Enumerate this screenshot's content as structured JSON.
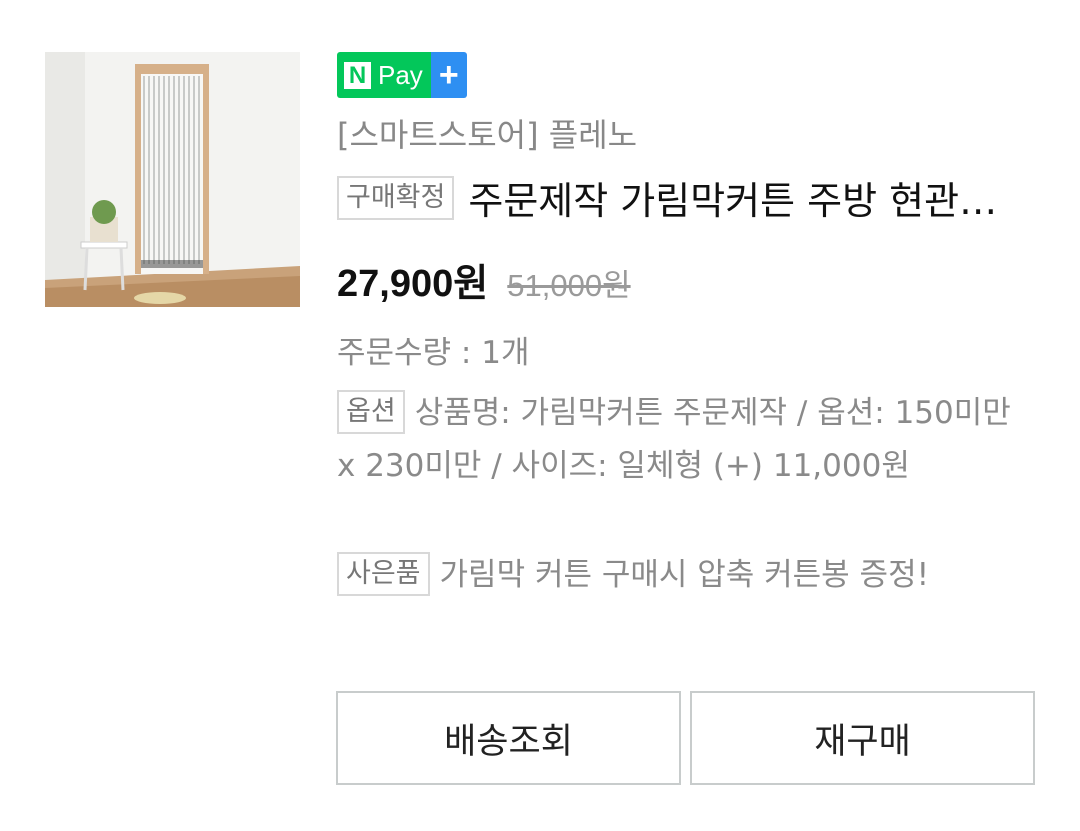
{
  "product": {
    "thumbnail_alt": "curtain-photo",
    "badge": {
      "n_letter": "N",
      "pay_text": "Pay",
      "plus": "+"
    },
    "store": "[스마트스토어] 플레노",
    "status_tag": "구매확정",
    "title": "주문제작 가림막커튼 주방 현관 문 커튼",
    "price": "27,900원",
    "original_price": "51,000원",
    "quantity": "주문수량 : 1개",
    "option_tag": "옵션",
    "option_text": "상품명: 가림막커튼 주문제작 / 옵션: 150미만 x 230미만 / 사이즈: 일체형 (+) 11,000원",
    "gift_tag": "사은품",
    "gift_text": "가림막 커튼 구매시 압축 커튼봉 증정!"
  },
  "buttons": {
    "track": "배송조회",
    "rebuy": "재구매"
  },
  "colors": {
    "npay_green": "#03c75a",
    "npay_blue": "#2e8ff2",
    "border": "#c8cccc"
  }
}
